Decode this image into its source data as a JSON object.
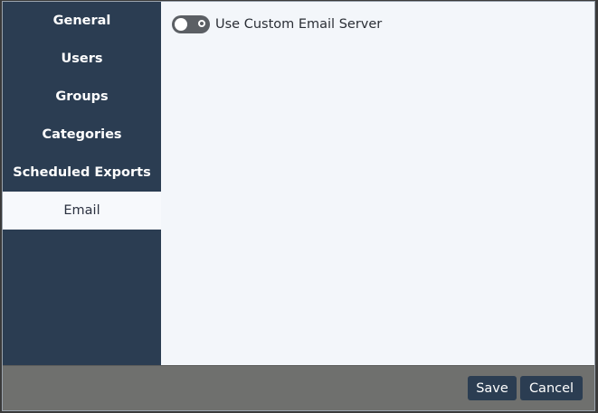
{
  "sidebar": {
    "items": [
      {
        "label": "General"
      },
      {
        "label": "Users"
      },
      {
        "label": "Groups"
      },
      {
        "label": "Categories"
      },
      {
        "label": "Scheduled Exports"
      },
      {
        "label": "Email"
      }
    ],
    "active_index": 5
  },
  "content": {
    "toggle_label": "Use Custom Email Server",
    "toggle_state": "off"
  },
  "footer": {
    "save_label": "Save",
    "cancel_label": "Cancel"
  },
  "colors": {
    "sidebar_bg": "#2b3d52",
    "active_item_bg": "#f7f9fc",
    "content_bg": "#f3f6fa",
    "footer_bg": "#6f706e",
    "button_bg": "#2b3d52",
    "toggle_bg": "#5b5f64"
  }
}
